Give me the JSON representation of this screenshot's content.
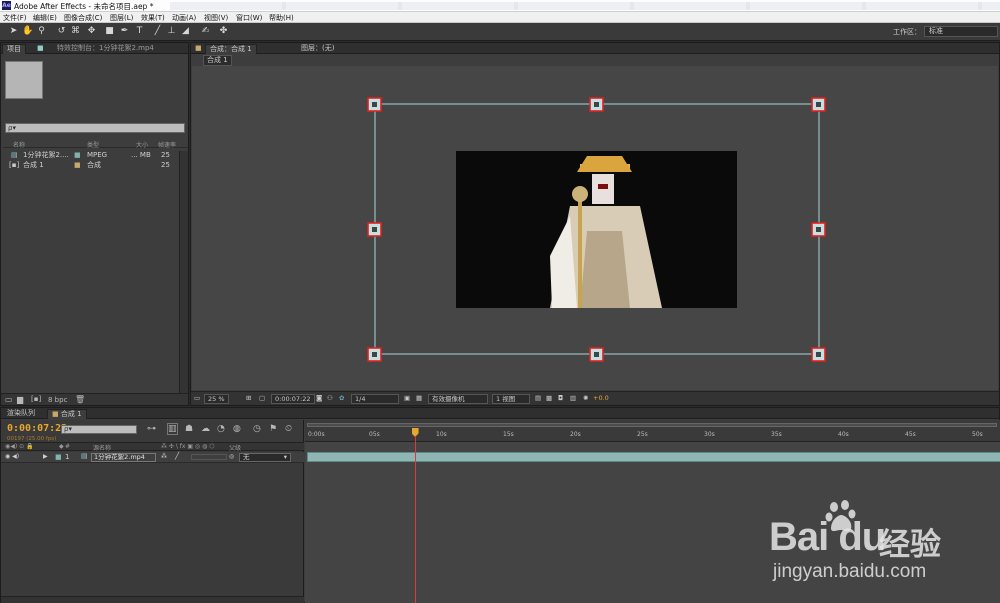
{
  "app": {
    "title": "Adobe After Effects - 未命名项目.aep *",
    "logo_text": "Ae"
  },
  "menus": [
    "文件(F)",
    "编辑(E)",
    "图像合成(C)",
    "图层(L)",
    "效果(T)",
    "动画(A)",
    "视图(V)",
    "窗口(W)",
    "帮助(H)"
  ],
  "toolbar": {
    "tools": [
      "selection-tool",
      "hand-tool",
      "zoom-tool",
      "rotate-tool",
      "camera-tool",
      "pan-behind-tool",
      "mask-tool",
      "pen-tool",
      "text-tool",
      "brush-tool",
      "clone-stamp-tool",
      "eraser-tool",
      "roto-brush-tool",
      "puppet-tool"
    ],
    "workspace_label": "工作区：",
    "workspace_value": "标准"
  },
  "project": {
    "tab_label": "项目",
    "effects_tab_label": "特效控制台：1分钟花絮2.mp4",
    "search_placeholder": "ρ▾",
    "columns": {
      "name": "名称",
      "type": "类型",
      "size": "大小",
      "fps": "帧速率"
    },
    "items": [
      {
        "name": "1分钟花絮2....",
        "type": "MPEG",
        "size": "... MB",
        "fps": "25",
        "label_color": "#7fb3b0"
      },
      {
        "name": "合成 1",
        "type": "合成",
        "size": "",
        "fps": "25",
        "label_color": "#c8a96b"
      }
    ],
    "footer_bpc": "8 bpc"
  },
  "composition": {
    "tab_label": "合成：合成 1",
    "layer_tab_label": "图层：(无)",
    "subtab": "合成 1",
    "footer": {
      "zoom": "25 %",
      "timecode": "0:00:07:22",
      "resolution": "1/4",
      "camera": "有效摄像机",
      "views": "1 视图",
      "exposure": "+0.0"
    }
  },
  "timeline": {
    "render_queue_tab": "渲染队列",
    "comp_tab": "合成 1",
    "current_time": "0:00:07:22",
    "frame_info": "00197 (25.00 fps)",
    "search_placeholder": "ρ▾",
    "columns": {
      "source_name": "源名称",
      "parent": "父级"
    },
    "layer": {
      "index": "1",
      "name": "1分钟花絮2.mp4",
      "parent": "无"
    },
    "ruler_labels": [
      "0:00s",
      "05s",
      "10s",
      "15s",
      "20s",
      "25s",
      "30s",
      "35s",
      "40s",
      "45s",
      "50s"
    ],
    "current_time_seconds": 7.88,
    "ruler_max_seconds": 50
  },
  "watermark": {
    "logo": "Bai du",
    "jingyan": "经验",
    "url": "jingyan.baidu.com"
  },
  "colors": {
    "accent_timecode": "#e8a72c",
    "layer_bar": "#8fb6b2",
    "highlight_box": "#e02020",
    "cti": "#d93a3a"
  }
}
